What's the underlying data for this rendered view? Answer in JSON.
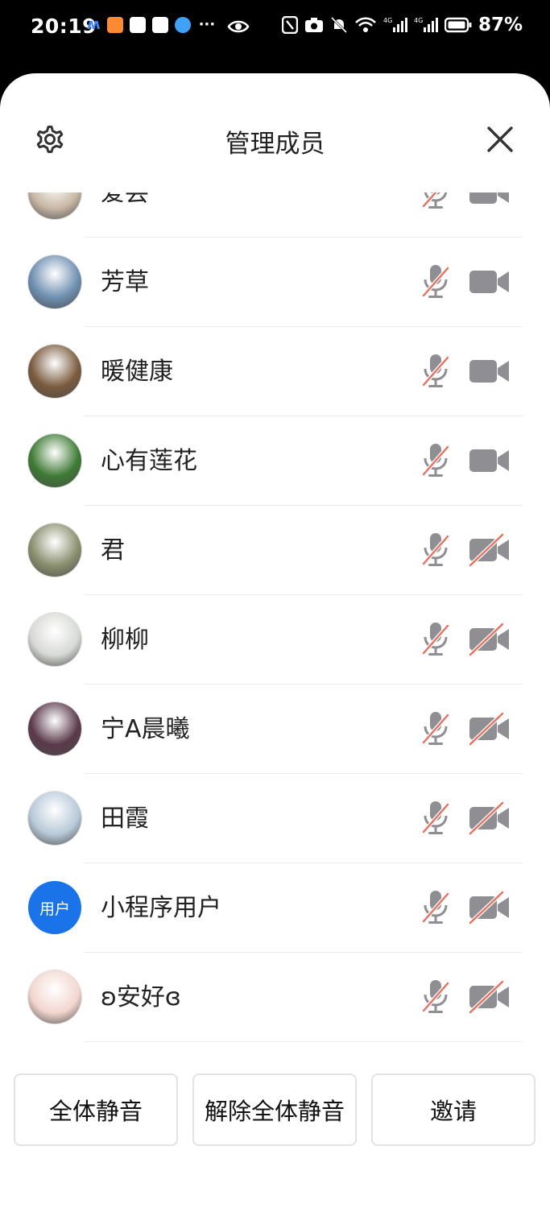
{
  "status_bar": {
    "time": "20:19",
    "battery": "87%",
    "icons": [
      "app-icons",
      "eye-icon",
      "nfc-icon",
      "camera-icon",
      "bell-off-icon",
      "wifi-icon",
      "signal-icon",
      "battery-icon"
    ]
  },
  "header": {
    "title": "管理成员",
    "settings_icon": "gear-icon",
    "close_icon": "close-icon"
  },
  "members": [
    {
      "name": "爱芸",
      "mic": "muted",
      "camera": "on",
      "avatar_color": "#c9b8a6"
    },
    {
      "name": "芳草",
      "mic": "muted",
      "camera": "on",
      "avatar_color": "#6e8fb0"
    },
    {
      "name": "暖健康",
      "mic": "muted",
      "camera": "on",
      "avatar_color": "#7a5b3e"
    },
    {
      "name": "心有莲花",
      "mic": "muted",
      "camera": "on",
      "avatar_color": "#3e7a34"
    },
    {
      "name": "君",
      "mic": "muted",
      "camera": "off",
      "avatar_color": "#8a8f6e"
    },
    {
      "name": "柳柳",
      "mic": "muted",
      "camera": "off",
      "avatar_color": "#d7d9d6"
    },
    {
      "name": "宁A晨曦",
      "mic": "muted",
      "camera": "off",
      "avatar_color": "#5a3a4a"
    },
    {
      "name": "田霞",
      "mic": "muted",
      "camera": "off",
      "avatar_color": "#b8c9d8"
    },
    {
      "name": "小程序用户",
      "mic": "muted",
      "camera": "off",
      "avatar_text": "用户",
      "avatar_color": "#1a73e8"
    },
    {
      "name": "ʚ安好ɞ",
      "mic": "muted",
      "camera": "off",
      "avatar_color": "#f3d6cf"
    }
  ],
  "actions": {
    "mute_all": "全体静音",
    "unmute_all": "解除全体静音",
    "invite": "邀请"
  },
  "colors": {
    "icon_gray": "#8e8e93",
    "mute_red": "#e8705f",
    "accent_blue": "#1a73e8"
  }
}
